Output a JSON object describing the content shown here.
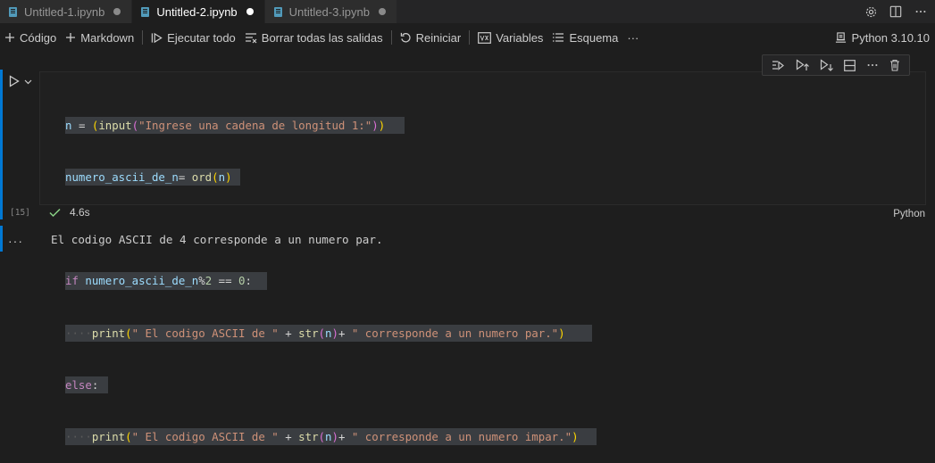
{
  "tabs": [
    {
      "label": "Untitled-1.ipynb",
      "active": false
    },
    {
      "label": "Untitled-2.ipynb",
      "active": true
    },
    {
      "label": "Untitled-3.ipynb",
      "active": false
    }
  ],
  "tab_actions": {
    "settings_icon": "gear-icon",
    "split_icon": "split-editor-icon",
    "more_icon": "ellipsis-icon"
  },
  "toolbar": {
    "add_code": "Código",
    "add_markdown": "Markdown",
    "run_all": "Ejecutar todo",
    "clear_outputs": "Borrar todas las salidas",
    "restart": "Reiniciar",
    "variables": "Variables",
    "outline": "Esquema",
    "more": "···",
    "kernel": "Python 3.10.10"
  },
  "cell": {
    "execution_count": "[15]",
    "code_lines": [
      "n = (input(\"Ingrese una cadena de longitud 1:\"))",
      "numero_ascii_de_n= ord(n)",
      "",
      "if numero_ascii_de_n%2 == 0:",
      "    print(\" El codigo ASCII de \" + str(n)+ \" corresponde a un numero par.\")",
      "else:",
      "    print(\" El codigo ASCII de \" + str(n)+ \" corresponde a un numero impar.\")"
    ],
    "status_duration": "4.6s",
    "language": "Python"
  },
  "output": {
    "more": "···",
    "text": "El codigo ASCII de 4 corresponde a un numero par."
  },
  "colors": {
    "accent": "#0078d4",
    "background": "#1e1e1e",
    "success": "#89d185",
    "keyword": "#c586c0",
    "string": "#ce9178",
    "variable": "#9cdcfe",
    "function": "#dcdcaa"
  }
}
